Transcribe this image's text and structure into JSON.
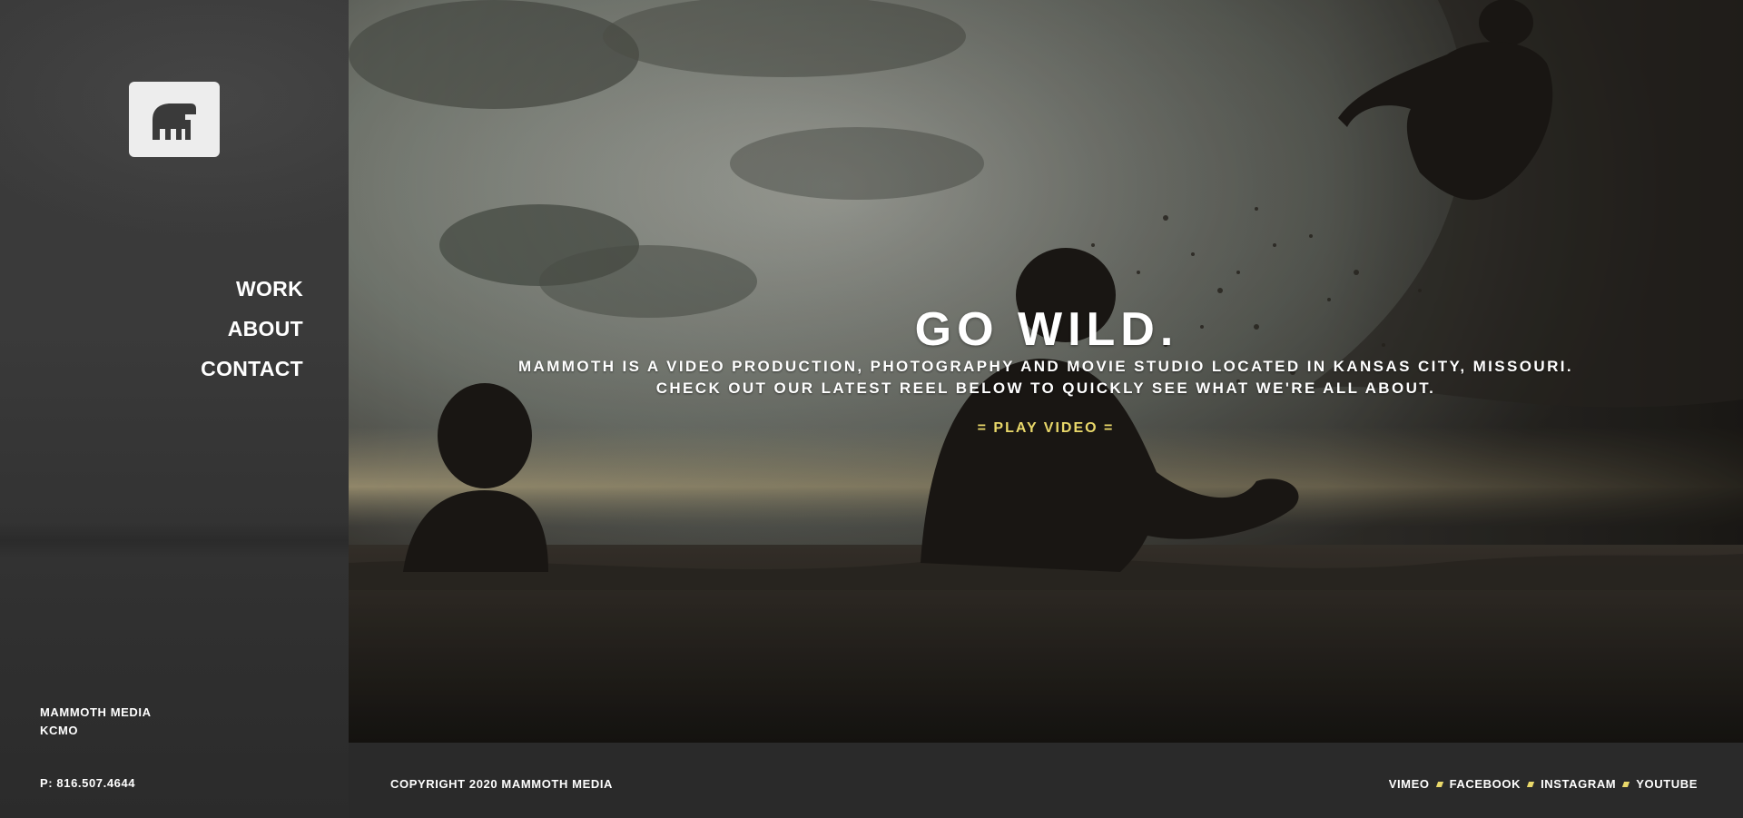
{
  "sidebar": {
    "logo_icon": "mammoth-logo-icon",
    "nav": [
      {
        "label": "WORK"
      },
      {
        "label": "ABOUT"
      },
      {
        "label": "CONTACT"
      }
    ],
    "address_line1": "MAMMOTH MEDIA",
    "address_line2": "KCMO",
    "phone": "P: 816.507.4644"
  },
  "hero": {
    "title": "GO WILD.",
    "line1": "MAMMOTH IS A VIDEO PRODUCTION, PHOTOGRAPHY AND MOVIE STUDIO LOCATED IN KANSAS CITY, MISSOURI.",
    "line2": "CHECK OUT OUR LATEST REEL BELOW TO QUICKLY SEE WHAT WE'RE ALL ABOUT.",
    "play_label": "= PLAY VIDEO ="
  },
  "footer": {
    "copyright": "COPYRIGHT 2020 MAMMOTH MEDIA",
    "social": [
      {
        "label": "VIMEO"
      },
      {
        "label": "FACEBOOK"
      },
      {
        "label": "INSTAGRAM"
      },
      {
        "label": "YOUTUBE"
      }
    ]
  },
  "colors": {
    "accent": "#e9d86a",
    "sidebar": "#3a3a3a",
    "footer": "#2a2a2a"
  }
}
